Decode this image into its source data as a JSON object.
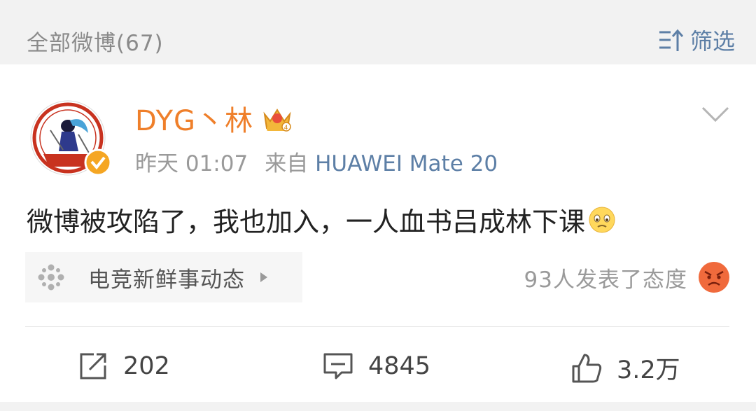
{
  "header": {
    "title": "全部微博(67)",
    "filter_label": "筛选",
    "filter_icon": "sort-filter-icon"
  },
  "post": {
    "avatar_icon": "dyg-team-avatar",
    "verified_icon": "verified-badge-icon",
    "username": "DYG丶林",
    "vip_icon": "crown-level-4-icon",
    "time": "昨天 01:07",
    "source_prefix": "来自",
    "device": "HUAWEI Mate 20",
    "text": "微博被攻陷了，我也加入，一人血书吕成林下课",
    "text_emoji": "sad-face-emoji",
    "topic": {
      "label": "电竞新鲜事动态",
      "icon": "cluster-dots-icon"
    },
    "reaction": {
      "text": "93人发表了态度",
      "icon": "angry-face-emoji"
    },
    "actions": {
      "share_count": "202",
      "comment_count": "4845",
      "like_count": "3.2万"
    }
  },
  "colors": {
    "accent_blue": "#5d7fa6",
    "username_orange": "#ef7f2a",
    "background": "#f2f2f2"
  }
}
